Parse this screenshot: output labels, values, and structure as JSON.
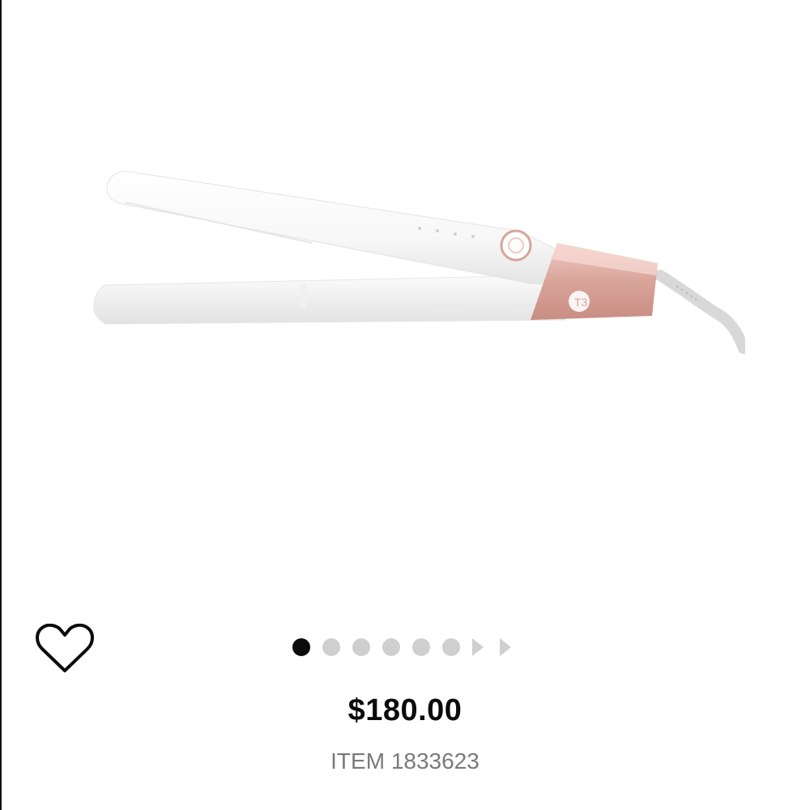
{
  "product": {
    "image_alt": "white and rose-gold flat iron hair straightener",
    "price": "$180.00",
    "item_number": "ITEM 1833623",
    "accent_color": "#d9a49a"
  },
  "favorite": {
    "icon": "heart-outline-icon"
  },
  "carousel": {
    "total_dots": 6,
    "active_index": 0,
    "arrows": [
      "chevron-right-icon",
      "chevron-right-icon"
    ]
  }
}
